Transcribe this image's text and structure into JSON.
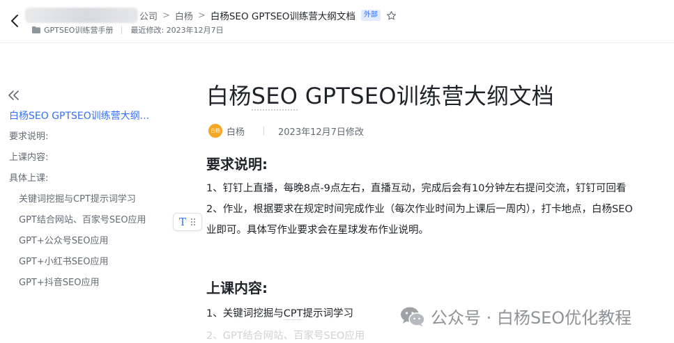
{
  "header": {
    "breadcrumb": [
      "公司",
      "白杨",
      "白杨SEO GPTSEO训练营大纲文档"
    ],
    "separator": ">",
    "badge": "外部",
    "folder": "GPTSEO训练营手册",
    "modified": "最近修改: 2023年12月7日"
  },
  "sidebar": {
    "items": [
      {
        "label": "白杨SEO GPTSEO训练营大纲..."
      },
      {
        "label": "要求说明:"
      },
      {
        "label": "上课内容:"
      },
      {
        "label": "具体上课:"
      },
      {
        "label": "关键词挖掘与CPT提示词学习"
      },
      {
        "label": "GPT结合网站、百家号SEO应用"
      },
      {
        "label": "GPT+公众号SEO应用"
      },
      {
        "label": "GPT+小红书SEO应用"
      },
      {
        "label": "GPT+抖音SEO应用"
      }
    ]
  },
  "doc": {
    "title_a": "白杨",
    "title_b": "SEO",
    "title_c": " GPTSEO训练营大纲文档",
    "avatar_text": "白杨",
    "author": "白杨",
    "modified": "2023年12月7日修改",
    "h_requirements": "要求说明:",
    "p1": "1、钉钉上直播，每晚8点-9点左右，直播互动，完成后会有10分钟左右提问交流，钉钉可回看",
    "p2": "2、作业，根据要求在规定时间完成作业（每次作业时间为上课后一周内），打卡地点，白杨SEO",
    "p2b": "业即可。具体写作业要求会在星球发布作业说明。",
    "h_content": "上课内容:",
    "p3_a": "1、关键词挖掘与",
    "p3_b": "CPT",
    "p3_c": "提示词学习",
    "p4": "2、GPT结合网站、百家号SEO应用"
  },
  "handle": {
    "label": "T"
  },
  "watermark": {
    "text": "公众号 · 白杨SEO优化教程"
  }
}
